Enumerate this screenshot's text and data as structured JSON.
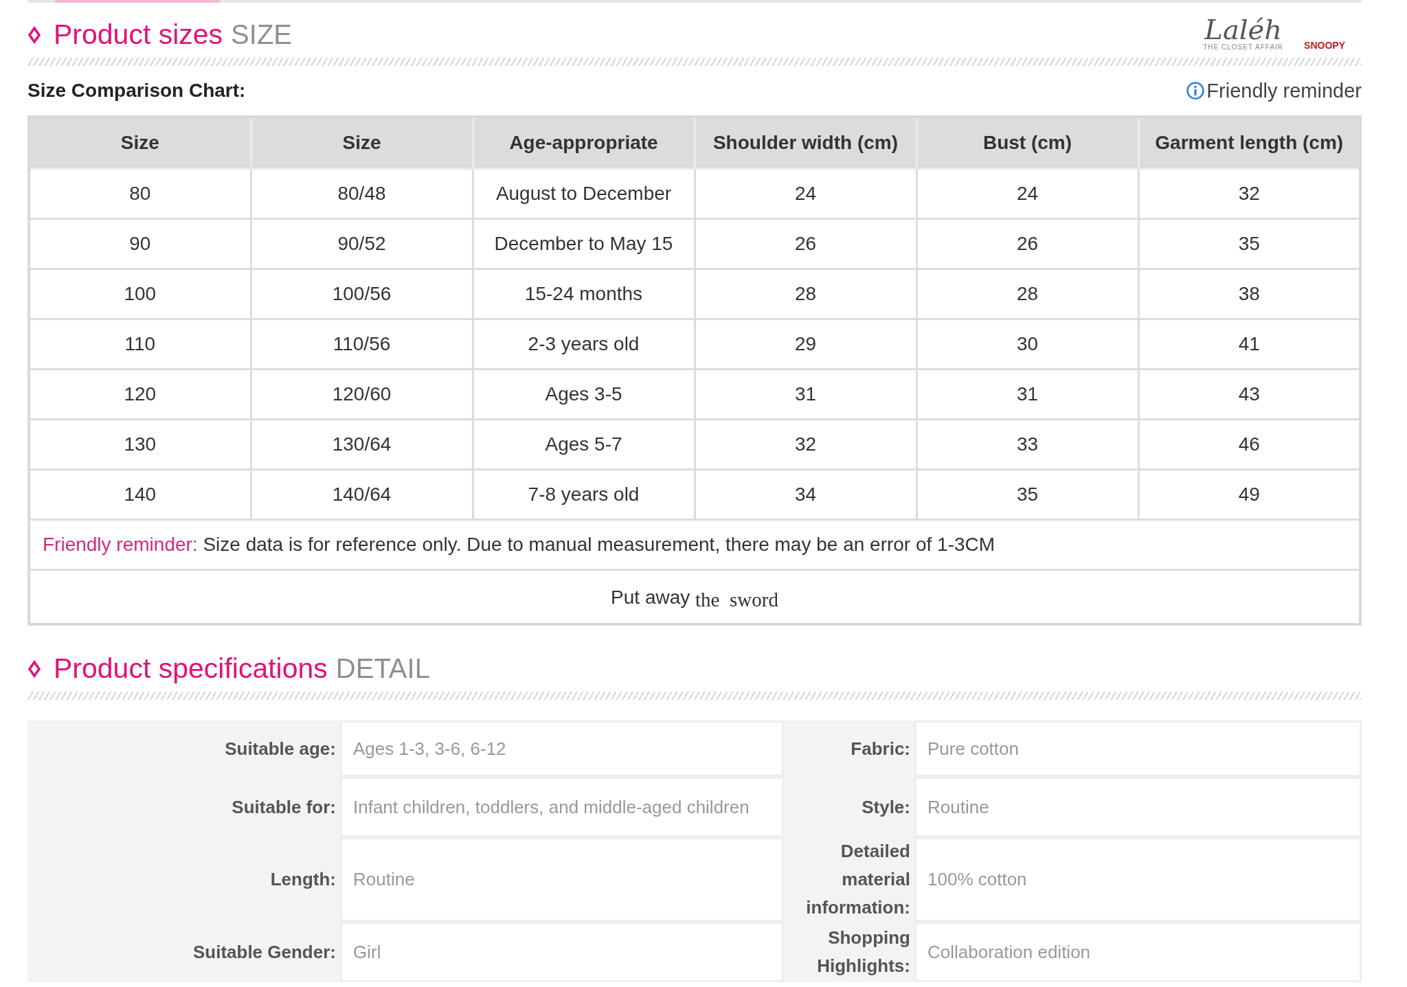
{
  "size_section": {
    "title": "Product sizes",
    "subtitle": "SIZE"
  },
  "brand": {
    "name": "Laléh",
    "tagline": "THE CLOSET AFFAIR",
    "partner": "SNOOPY"
  },
  "chart_heading": "Size Comparison Chart:",
  "reminder_link": "Friendly reminder",
  "size_table": {
    "columns": [
      "Size",
      "Size",
      "Age-appropriate",
      "Shoulder width (cm)",
      "Bust (cm)",
      "Garment length (cm)"
    ],
    "rows": [
      [
        "80",
        "80/48",
        "August to December",
        "24",
        "24",
        "32"
      ],
      [
        "90",
        "90/52",
        "December to May 15",
        "26",
        "26",
        "35"
      ],
      [
        "100",
        "100/56",
        "15-24 months",
        "28",
        "28",
        "38"
      ],
      [
        "110",
        "110/56",
        "2-3 years old",
        "29",
        "30",
        "41"
      ],
      [
        "120",
        "120/60",
        "Ages 3-5",
        "31",
        "31",
        "43"
      ],
      [
        "130",
        "130/64",
        "Ages 5-7",
        "32",
        "33",
        "46"
      ],
      [
        "140",
        "140/64",
        "7-8 years old",
        "34",
        "35",
        "49"
      ]
    ],
    "note": {
      "label": "Friendly reminder:",
      "text": "Size data is for reference only. Due to manual measurement, there may be an error of 1-3CM"
    },
    "footer": {
      "part_1": "Put away",
      "part_2": "the  sword"
    }
  },
  "spec_section": {
    "title": "Product specifications",
    "subtitle": "DETAIL"
  },
  "specs": [
    {
      "cells": [
        {
          "label": "Suitable age:",
          "value": "Ages 1-3, 3-6, 6-12"
        },
        {
          "label": "Fabric:",
          "value": "Pure cotton"
        }
      ]
    },
    {
      "cells": [
        {
          "label": "Suitable for:",
          "value": "Infant children, toddlers, and middle-aged children"
        },
        {
          "label": "Style:",
          "value": "Routine"
        }
      ]
    },
    {
      "cells": [
        {
          "label": "Length:",
          "value": "Routine"
        },
        {
          "label": "Detailed material information:",
          "value": "100% cotton"
        }
      ]
    },
    {
      "cells": [
        {
          "label": "Suitable Gender:",
          "value": "Girl"
        },
        {
          "label": "Shopping Highlights:",
          "value": "Collaboration edition"
        }
      ]
    }
  ]
}
